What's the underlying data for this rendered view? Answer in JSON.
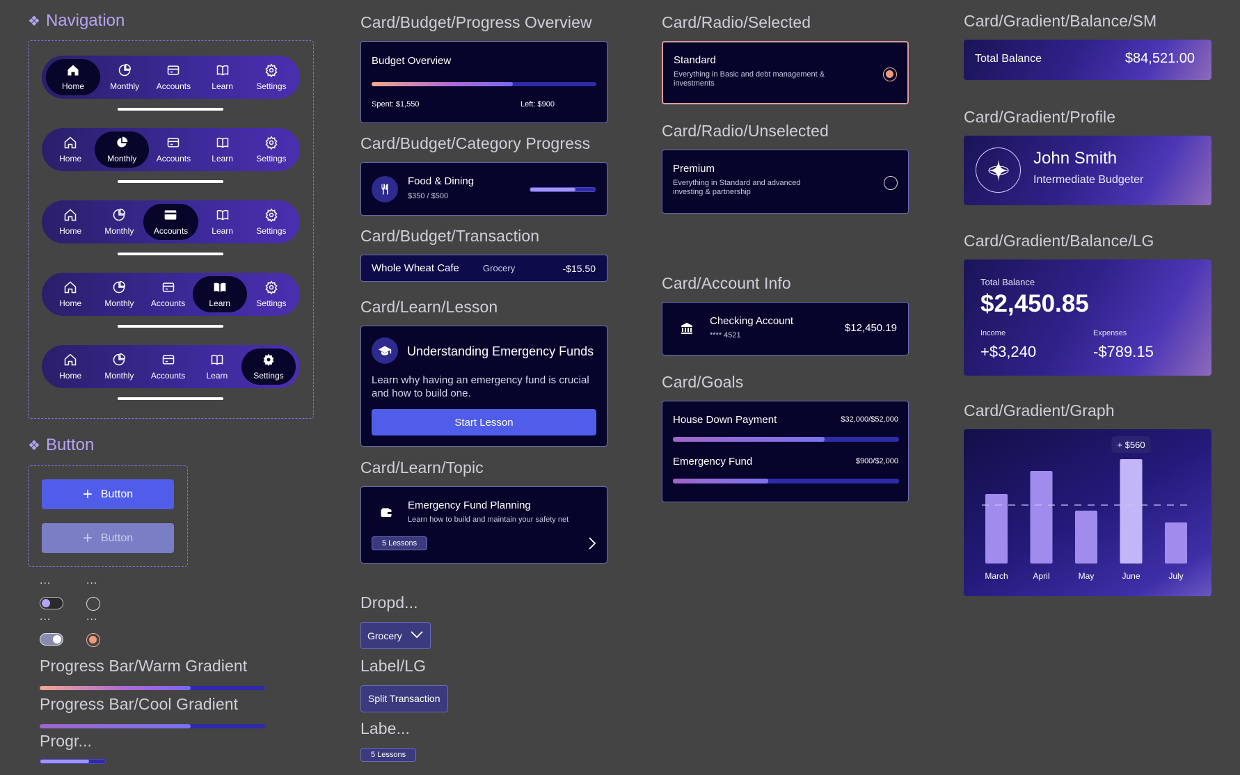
{
  "navigation": {
    "title": "Navigation",
    "items": [
      "Home",
      "Monthly",
      "Accounts",
      "Learn",
      "Settings"
    ]
  },
  "button": {
    "title": "Button",
    "primary_label": "Button",
    "disabled_label": "Button"
  },
  "misc_labels": {
    "dots": "..."
  },
  "progress": {
    "warm_title": "Progress Bar/Warm Gradient",
    "cool_title": "Progress Bar/Cool Gradient",
    "small_title": "Progr...",
    "warm_value": 0.67,
    "cool_value": 0.67,
    "small_value": 0.75
  },
  "budget_overview": {
    "section": "Card/Budget/Progress Overview",
    "title": "Budget Overview",
    "spent": "Spent: $1,550",
    "left": "Left: $900",
    "progress": 0.63
  },
  "category_progress": {
    "section": "Card/Budget/Category Progress",
    "name": "Food & Dining",
    "amount": "$350 / $500",
    "progress": 0.7
  },
  "transaction": {
    "section": "Card/Budget/Transaction",
    "merchant": "Whole Wheat Cafe",
    "category": "Grocery",
    "amount": "-$15.50"
  },
  "lesson": {
    "section": "Card/Learn/Lesson",
    "title": "Understanding Emergency Funds",
    "body": "Learn why having an emergency fund is crucial and how to build one.",
    "cta": "Start Lesson"
  },
  "topic": {
    "section": "Card/Learn/Topic",
    "title": "Emergency Fund Planning",
    "subtitle": "Learn how to build and maintain your safety net",
    "badge": "5 Lessons"
  },
  "dropdown": {
    "section": "Dropd...",
    "value": "Grocery"
  },
  "label_lg": {
    "section": "Label/LG",
    "text": "Split Transaction"
  },
  "label_sm": {
    "section": "Labe...",
    "text": "5 Lessons"
  },
  "radio_selected": {
    "section": "Card/Radio/Selected",
    "title": "Standard",
    "desc": "Everything in Basic and debt management & investments"
  },
  "radio_unselected": {
    "section": "Card/Radio/Unselected",
    "title": "Premium",
    "desc": "Everything in Standard and advanced investing & partnership"
  },
  "account_info": {
    "section": "Card/Account Info",
    "name": "Checking Account",
    "number": "**** 4521",
    "balance": "$12,450.19"
  },
  "goals": {
    "section": "Card/Goals",
    "items": [
      {
        "name": "House Down Payment",
        "amount": "$32,000/$52,000",
        "progress": 0.67
      },
      {
        "name": "Emergency Fund",
        "amount": "$900/$2,000",
        "progress": 0.42
      }
    ]
  },
  "balance_sm": {
    "section": "Card/Gradient/Balance/SM",
    "label": "Total Balance",
    "value": "$84,521.00"
  },
  "profile": {
    "section": "Card/Gradient/Profile",
    "name": "John Smith",
    "level": "Intermediate Budgeter"
  },
  "balance_lg": {
    "section": "Card/Gradient/Balance/LG",
    "label": "Total Balance",
    "value": "$2,450.85",
    "income_label": "Income",
    "income_value": "+$3,240",
    "expenses_label": "Expenses",
    "expenses_value": "-$789.15"
  },
  "graph": {
    "section": "Card/Gradient/Graph",
    "tooltip": "+ $560"
  },
  "chart_data": {
    "type": "bar",
    "categories": [
      "March",
      "April",
      "May",
      "June",
      "July"
    ],
    "values": [
      100,
      133,
      76,
      150,
      59
    ],
    "highlight_index": 3,
    "average_line": 84
  }
}
